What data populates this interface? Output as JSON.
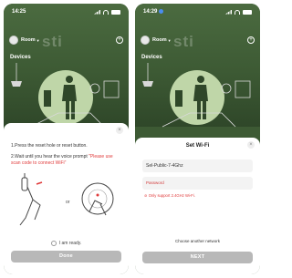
{
  "left": {
    "status": {
      "time": "14:25"
    },
    "header": {
      "room": "Room",
      "watermark": "sti"
    },
    "devices_label": "Devices",
    "sheet": {
      "close": "×",
      "step1": "1.Press the reset hole or reset button.",
      "step2_text": "2.Wait until you hear the voice prompt",
      "step2_hint": "\"Please use scan code to connect WiFi\"",
      "or_label": "or",
      "ready_label": "I am ready.",
      "done_button": "Done"
    }
  },
  "right": {
    "status": {
      "time": "14:29"
    },
    "header": {
      "room": "Room",
      "watermark": "sti"
    },
    "devices_label": "Devices",
    "sheet": {
      "title": "Set Wi-Fi",
      "close": "×",
      "ssid_value": "Sel-Public-7-4Ghz",
      "password_placeholder": "Password",
      "warning": "Only support 2.4GHz Wi-Fi.",
      "choose_network": "Choose another network",
      "next_button": "NEXT"
    }
  },
  "colors": {
    "app_background": "#3d5a34",
    "sheet": "#ffffff",
    "button_disabled": "#b8b8b8",
    "error": "#e03b3b",
    "accent_circle": "#bfd6a8"
  }
}
